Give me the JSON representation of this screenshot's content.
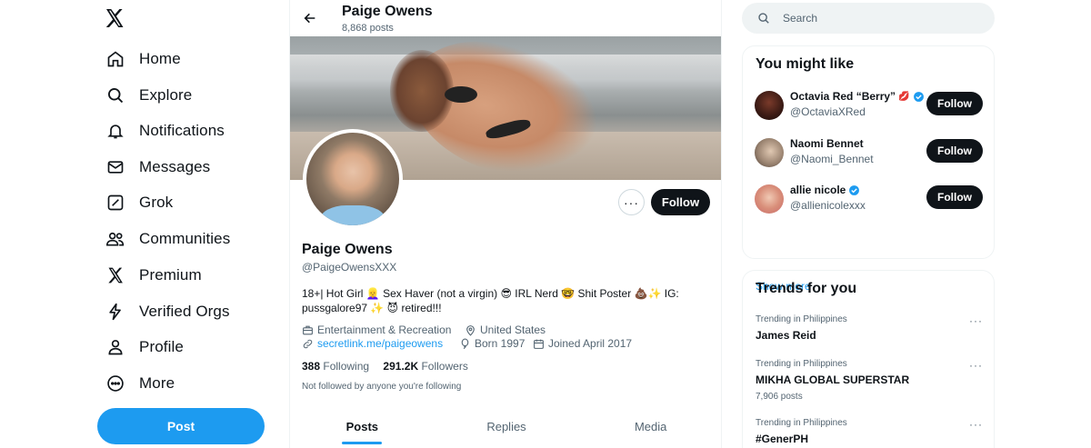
{
  "nav": {
    "logo": "x-logo-icon",
    "items": [
      {
        "label": "Home",
        "icon": "home-icon"
      },
      {
        "label": "Explore",
        "icon": "search-icon"
      },
      {
        "label": "Notifications",
        "icon": "bell-icon"
      },
      {
        "label": "Messages",
        "icon": "envelope-icon"
      },
      {
        "label": "Grok",
        "icon": "grok-icon"
      },
      {
        "label": "Communities",
        "icon": "people-icon"
      },
      {
        "label": "Premium",
        "icon": "x-logo-icon"
      },
      {
        "label": "Verified Orgs",
        "icon": "lightning-icon"
      },
      {
        "label": "Profile",
        "icon": "person-icon"
      },
      {
        "label": "More",
        "icon": "more-circle-icon"
      }
    ],
    "post_label": "Post"
  },
  "header": {
    "name": "Paige Owens",
    "posts_count": "8,868 posts"
  },
  "profile": {
    "name": "Paige Owens",
    "handle": "@PaigeOwensXXX",
    "more_label": "···",
    "follow_label": "Follow",
    "bio_line1": "18+| Hot Girl 👱‍♀️ Sex Haver (not a virgin) 😎 IRL Nerd 🤓 Shit Poster 💩✨ IG:",
    "bio_line2": "pussgalore97 ✨ 😈 retired!!!",
    "category": "Entertainment & Recreation",
    "location": "United States",
    "link": "secretlink.me/paigeowens",
    "born": "Born 1997",
    "joined": "Joined April 2017",
    "following_count": "388",
    "following_label": "Following",
    "followers_count": "291.2K",
    "followers_label": "Followers",
    "not_followed": "Not followed by anyone you're following"
  },
  "tabs": [
    "Posts",
    "Replies",
    "Media"
  ],
  "search": {
    "placeholder": "Search"
  },
  "suggestions": {
    "title": "You might like",
    "users": [
      {
        "name": "Octavia Red “Berry”",
        "badge": "💋",
        "handle": "@OctaviaXRed",
        "button": "Follow"
      },
      {
        "name": "Naomi Bennet",
        "handle": "@Naomi_Bennet",
        "button": "Follow"
      },
      {
        "name": "allie nicole",
        "handle": "@allienicolexxx",
        "button": "Follow"
      }
    ],
    "show_more": "Show more"
  },
  "trends": {
    "title": "Trends for you",
    "items": [
      {
        "context": "Trending in Philippines",
        "topic": "James Reid",
        "count": ""
      },
      {
        "context": "Trending in Philippines",
        "topic": "MIKHA GLOBAL SUPERSTAR",
        "count": "7,906 posts"
      },
      {
        "context": "Trending in Philippines",
        "topic": "#GenerPH",
        "count": ""
      }
    ],
    "more": "···"
  },
  "colors": {
    "accent": "#1d9bf0",
    "text": "#0f1419",
    "muted": "#536471",
    "button_dark": "#0f1419"
  }
}
